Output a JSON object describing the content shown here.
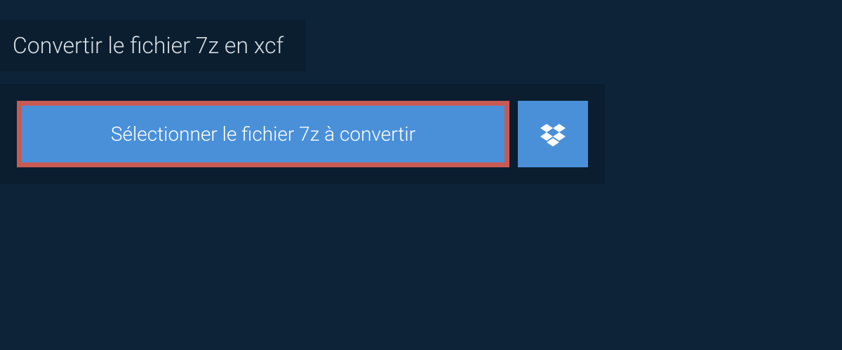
{
  "header": {
    "title": "Convertir le fichier 7z en xcf"
  },
  "upload": {
    "select_button_label": "Sélectionner le fichier 7z à convertir",
    "dropbox_icon_name": "dropbox"
  },
  "colors": {
    "background": "#0d2438",
    "panel": "#0a1e30",
    "button": "#4a90d9",
    "highlight_border": "#c85a54",
    "text_light": "#d8dde2",
    "text_white": "#ffffff"
  }
}
